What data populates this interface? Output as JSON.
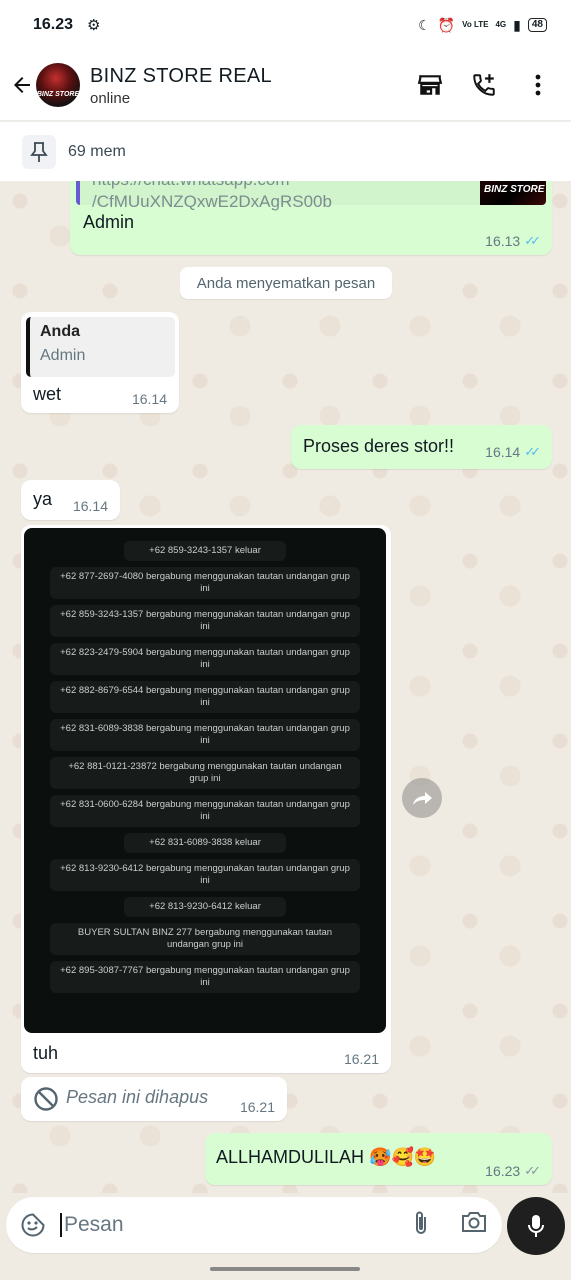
{
  "status_bar": {
    "time": "16.23",
    "network": "Vo LTE",
    "signal": "4G",
    "battery": "48"
  },
  "header": {
    "title": "BINZ STORE REAL",
    "status": "online",
    "avatar_text": "BINZ STORE"
  },
  "pinned": {
    "label": "69 mem"
  },
  "messages": {
    "m1": {
      "url_line1": "https://chat.whatsapp.com",
      "url_line2": "/CfMUuXNZQxwE2DxAgRS00b",
      "thumb_text": "BINZ STORE",
      "text": "Admin",
      "time": "16.13"
    },
    "system": {
      "text": "Anda menyematkan pesan"
    },
    "m2": {
      "quote_name": "Anda",
      "quote_text": "Admin",
      "text": "wet",
      "time": "16.14"
    },
    "m3": {
      "text": "Proses deres stor!!",
      "time": "16.14"
    },
    "m4": {
      "text": "ya",
      "time": "16.14"
    },
    "m5": {
      "screenshot_rows": [
        "+62 859-3243-1357 keluar",
        "+62 877-2697-4080 bergabung menggunakan tautan undangan grup ini",
        "+62 859-3243-1357 bergabung menggunakan tautan undangan grup ini",
        "+62 823-2479-5904 bergabung menggunakan tautan undangan grup ini",
        "+62 882-8679-6544 bergabung menggunakan tautan undangan grup ini",
        "+62 831-6089-3838 bergabung menggunakan tautan undangan grup ini",
        "+62 881-0121-23872 bergabung menggunakan tautan undangan grup ini",
        "+62 831-0600-6284 bergabung menggunakan tautan undangan grup ini",
        "+62 831-6089-3838 keluar",
        "+62 813-9230-6412 bergabung menggunakan tautan undangan grup ini",
        "+62 813-9230-6412 keluar",
        "BUYER SULTAN BINZ 277 bergabung menggunakan tautan undangan grup ini",
        "+62 895-3087-7767 bergabung menggunakan tautan undangan grup ini"
      ],
      "text": "tuh",
      "time": "16.21"
    },
    "m6": {
      "text": "Pesan ini dihapus",
      "time": "16.21"
    },
    "m7": {
      "text": "ALLHAMDULILAH 🥵🥰🤩",
      "time": "16.23"
    }
  },
  "input": {
    "placeholder": "Pesan"
  },
  "colors": {
    "outgoing": "#d9fdd3",
    "incoming": "#ffffff",
    "read_ticks": "#53bdeb",
    "background": "#efeae2"
  }
}
